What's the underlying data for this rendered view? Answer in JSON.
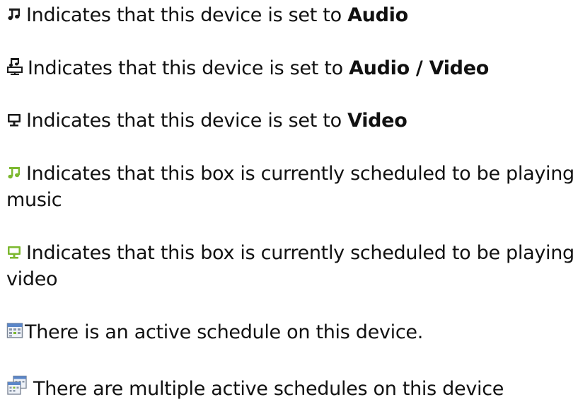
{
  "colors": {
    "text": "#111111",
    "icon_dark": "#1a1a1a",
    "icon_green": "#7cb82f",
    "calendar_blue": "#5b86c8"
  },
  "legend": [
    {
      "icon": "music-note-icon",
      "text": "Indicates that this device is set to ",
      "emphasis": "Audio"
    },
    {
      "icon": "audio-video-icon",
      "text": "Indicates that this device is set to ",
      "emphasis": "Audio / Video"
    },
    {
      "icon": "monitor-icon",
      "text": "Indicates that this device is set to ",
      "emphasis": "Video"
    },
    {
      "icon": "music-note-green-icon",
      "text": "Indicates that this box is currently scheduled to be playing music"
    },
    {
      "icon": "monitor-green-icon",
      "text": "Indicates that this box is currently scheduled to be playing video"
    },
    {
      "icon": "calendar-icon",
      "text": "There is an active schedule on this device."
    },
    {
      "icon": "calendar-multiple-icon",
      "text": "There are multiple active schedules on this device"
    }
  ]
}
